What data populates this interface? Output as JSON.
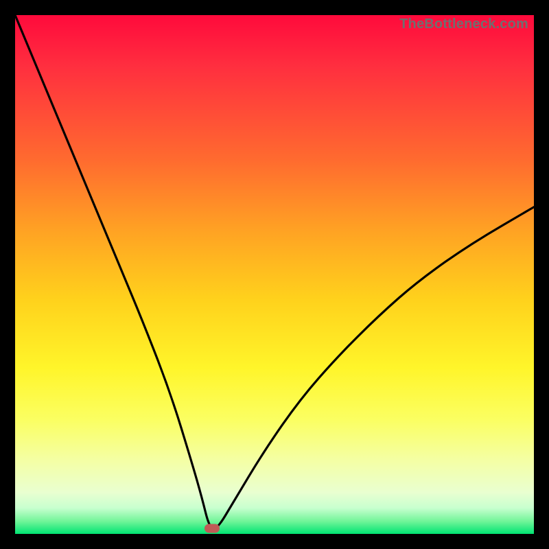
{
  "watermark": "TheBottleneck.com",
  "colors": {
    "frame": "#000000",
    "curve": "#000000",
    "marker": "#c05a56",
    "gradient_top": "#ff0a3c",
    "gradient_bottom": "#00e472"
  },
  "chart_data": {
    "type": "line",
    "title": "",
    "xlabel": "",
    "ylabel": "",
    "xlim": [
      0,
      100
    ],
    "ylim": [
      0,
      100
    ],
    "grid": false,
    "legend": false,
    "series": [
      {
        "name": "bottleneck-curve",
        "x": [
          0,
          5,
          10,
          15,
          20,
          25,
          30,
          34,
          36,
          37.5,
          39,
          42,
          48,
          55,
          62,
          70,
          78,
          88,
          100
        ],
        "y": [
          100,
          88,
          76,
          64,
          52,
          40,
          27,
          14,
          7,
          1,
          1,
          6,
          16,
          26,
          34,
          42,
          49,
          56,
          63
        ]
      }
    ],
    "annotations": [
      {
        "name": "optimal-marker",
        "x": 38,
        "y": 1
      }
    ]
  }
}
